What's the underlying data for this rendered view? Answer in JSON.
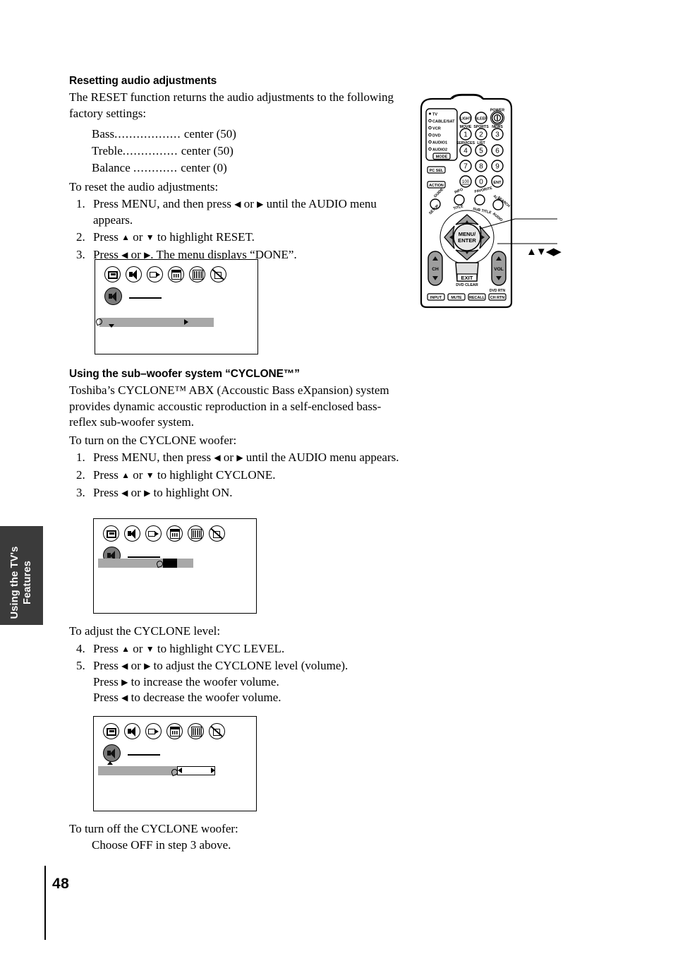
{
  "page": {
    "number": "48",
    "side_tab_line1": "Using the TV's",
    "side_tab_line2": "Features"
  },
  "section1": {
    "heading": "Resetting audio adjustments",
    "intro": "The RESET function returns the audio adjustments to the following factory settings:",
    "settings": [
      {
        "name": "Bass",
        "dots": "..................",
        "value": "center (50)"
      },
      {
        "name": "Treble",
        "dots": "...............",
        "value": "center (50)"
      },
      {
        "name": "Balance",
        "dots": "............",
        "value": "center (0)"
      }
    ],
    "lead_in": "To reset the audio adjustments:",
    "steps": [
      {
        "num": "1.",
        "text_a": "Press MENU, and then press ",
        "arrow1": "◀",
        "mid": " or ",
        "arrow2": "▶",
        "text_b": " until the AUDIO menu appears."
      },
      {
        "num": "2.",
        "text_a": "Press ",
        "arrow1": "▲",
        "mid": " or ",
        "arrow2": "▼",
        "text_b": " to highlight RESET."
      },
      {
        "num": "3.",
        "text_a": "Press ",
        "arrow1": "◀",
        "mid": " or ",
        "arrow2": "▶",
        "text_b": ". The menu displays “DONE”."
      }
    ]
  },
  "section2": {
    "heading": "Using the sub–woofer system “CYCLONE™”",
    "intro": "Toshiba’s CYCLONE™ ABX (Accoustic Bass eXpansion) system provides dynamic accoustic reproduction in a self-enclosed bass-reflex sub-woofer system.",
    "lead_in": "To turn on the CYCLONE woofer:",
    "steps": [
      {
        "num": "1.",
        "text_a": "Press MENU, then press ",
        "arrow1": "◀",
        "mid": " or ",
        "arrow2": "▶",
        "text_b": " until the AUDIO menu appears."
      },
      {
        "num": "2.",
        "text_a": "Press ",
        "arrow1": "▲",
        "mid": " or ",
        "arrow2": "▼",
        "text_b": " to highlight CYCLONE."
      },
      {
        "num": "3.",
        "text_a": "Press ",
        "arrow1": "◀",
        "mid": " or ",
        "arrow2": "▶",
        "text_b": " to highlight ON."
      }
    ],
    "lead_in2": "To adjust the CYCLONE level:",
    "steps2": [
      {
        "num": "4.",
        "text_a": "Press ",
        "arrow1": "▲",
        "mid": " or ",
        "arrow2": "▼",
        "text_b": " to highlight CYC LEVEL."
      },
      {
        "num": "5.",
        "text_a": "Press ",
        "arrow1": "◀",
        "mid": " or ",
        "arrow2": "▶",
        "text_b": " to adjust the CYCLONE level (volume)."
      }
    ],
    "sub_a_pre": "Press ",
    "sub_a_arrow": "▶",
    "sub_a_post": " to increase the woofer volume.",
    "sub_b_pre": "Press ",
    "sub_b_arrow": "◀",
    "sub_b_post": " to decrease the woofer volume.",
    "lead_in3": "To turn off the CYCLONE woofer:",
    "closing": "Choose OFF in step 3 above."
  },
  "osd_menus": {
    "icon_names": [
      "picture-icon",
      "audio-icon",
      "video-icon",
      "channel-icon",
      "setup-icon",
      "lock-icon"
    ],
    "menu1_name": "audio-menu-reset",
    "menu2_name": "audio-menu-cyclone-on",
    "menu3_name": "audio-menu-cyc-level"
  },
  "remote": {
    "mode_list": [
      "TV",
      "CABLE/SAT",
      "VCR",
      "DVD",
      "AUDIO1",
      "AUDIO2"
    ],
    "mode_button": "MODE",
    "pc_sel": "PC SEL",
    "action": "ACTION",
    "light": "LIGHT",
    "sleep": "SLEEP",
    "power_label": "POWER",
    "keys": [
      {
        "label": "1",
        "top": "MOVIE"
      },
      {
        "label": "2",
        "top": "SPORTS"
      },
      {
        "label": "3",
        "top": "NEWS"
      },
      {
        "label": "4",
        "top": "SERVICES"
      },
      {
        "label": "5",
        "top": "LIST"
      },
      {
        "label": "6",
        "top": ""
      },
      {
        "label": "7",
        "top": ""
      },
      {
        "label": "8",
        "top": ""
      },
      {
        "label": "9",
        "top": ""
      },
      {
        "label": "100",
        "top": ""
      },
      {
        "label": "0",
        "top": ""
      },
      {
        "label": "ENT",
        "top": ""
      }
    ],
    "guide": "GUIDE",
    "setup": "SETUP",
    "info": "INFO",
    "title": "TITLE",
    "favorite": "FAVORITE",
    "sub_title": "SUB TITLE",
    "alpha1": "ALPHA",
    "alpha2": "SEARCH",
    "audio": "AUDIO",
    "menu_enter_l1": "MENU/",
    "menu_enter_l2": "ENTER",
    "ch": "CH",
    "vol": "VOL",
    "exit": "EXIT",
    "dvd_clear": "DVD CLEAR",
    "bottom_row": [
      "INPUT",
      "MUTE",
      "RECALL"
    ],
    "ch_rtn_l1": "DVD RTN",
    "ch_rtn_l2": "CH RTN",
    "callout_arrows": "▲▼◀▶"
  }
}
